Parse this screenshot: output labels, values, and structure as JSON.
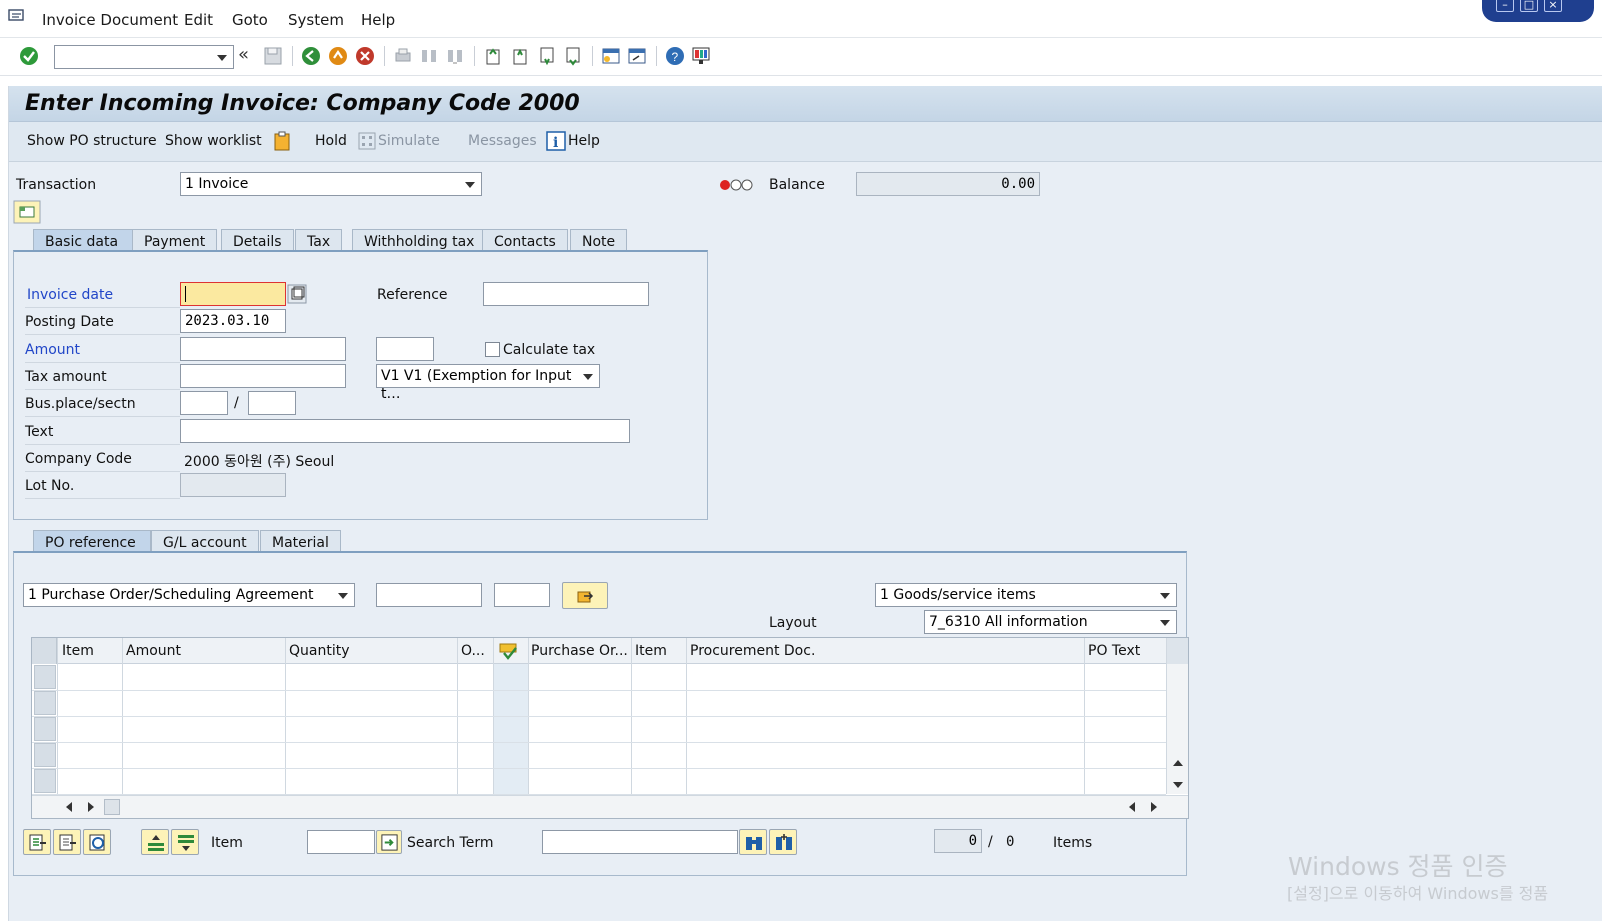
{
  "menubar": {
    "items": [
      "Invoice Document",
      "Edit",
      "Goto",
      "System",
      "Help"
    ]
  },
  "header": {
    "title": "Enter Incoming Invoice: Company Code 2000"
  },
  "app_toolbar": {
    "show_po_structure": "Show PO structure",
    "show_worklist": "Show worklist",
    "hold": "Hold",
    "simulate": "Simulate",
    "messages": "Messages",
    "help": "Help"
  },
  "top": {
    "transaction_label": "Transaction",
    "transaction_value": "1 Invoice",
    "balance_label": "Balance",
    "balance_value": "0.00"
  },
  "tabs": [
    "Basic data",
    "Payment",
    "Details",
    "Tax",
    "Withholding tax",
    "Contacts",
    "Note"
  ],
  "basic": {
    "invoice_date_label": "Invoice date",
    "invoice_date_value": "",
    "posting_date_label": "Posting Date",
    "posting_date_value": "2023.03.10",
    "amount_label": "Amount",
    "tax_amount_label": "Tax amount",
    "bus_place_label": "Bus.place/sectn",
    "slash": "/",
    "text_label": "Text",
    "company_code_label": "Company Code",
    "company_code_value": "2000 동아원 (주) Seoul",
    "lot_no_label": "Lot No.",
    "reference_label": "Reference",
    "calculate_tax_label": "Calculate tax",
    "tax_code_value": "V1 V1 (Exemption for Input t…"
  },
  "ref_tabs": [
    "PO reference",
    "G/L account",
    "Material"
  ],
  "po": {
    "ref_type": "1 Purchase Order/Scheduling Agreement",
    "items_type": "1 Goods/service items",
    "layout_label": "Layout",
    "layout_value": "7_6310 All information"
  },
  "grid": {
    "columns": [
      "Item",
      "Amount",
      "Quantity",
      "O...",
      "",
      "Purchase Or...",
      "Item",
      "Procurement Doc.",
      "PO Text"
    ],
    "rows": 5
  },
  "footer": {
    "item_label": "Item",
    "search_term_label": "Search Term",
    "count_value": "0",
    "slash": "/",
    "total_value": "0",
    "items_label": "Items"
  },
  "watermark": {
    "line1": "Windows 정품 인증",
    "line2": "[설정]으로 이동하여 Windows를 정품"
  },
  "colors": {
    "accent_blue": "#2146c8",
    "panel_bg": "#e8eef5",
    "title_bar": "#c4d5e6"
  }
}
